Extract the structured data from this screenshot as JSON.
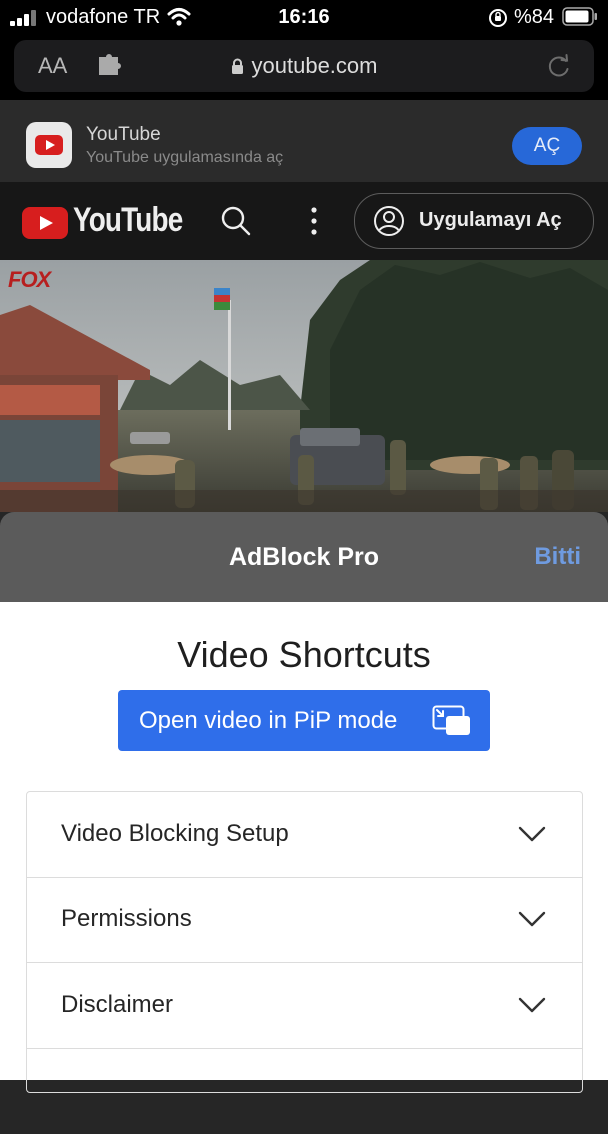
{
  "status": {
    "carrier": "vodafone TR",
    "time": "16:16",
    "battery": "%84"
  },
  "safari": {
    "text_size": "AA",
    "url": "youtube.com"
  },
  "banner": {
    "title": "YouTube",
    "subtitle": "YouTube uygulamasında aç",
    "open_label": "AÇ"
  },
  "youtube": {
    "logo_text": "YouTube",
    "open_app_label": "Uygulamayı Aç"
  },
  "video": {
    "watermark": "FOX"
  },
  "sheet": {
    "title": "AdBlock Pro",
    "done_label": "Bitti"
  },
  "content": {
    "heading": "Video Shortcuts",
    "pip_label": "Open video in PiP mode",
    "sections": [
      "Video Blocking Setup",
      "Permissions",
      "Disclaimer",
      ""
    ]
  },
  "colors": {
    "accent": "#2f6eea",
    "done": "#6f9be0",
    "banner_button": "#2768d8",
    "youtube_red": "#d71e1e"
  }
}
